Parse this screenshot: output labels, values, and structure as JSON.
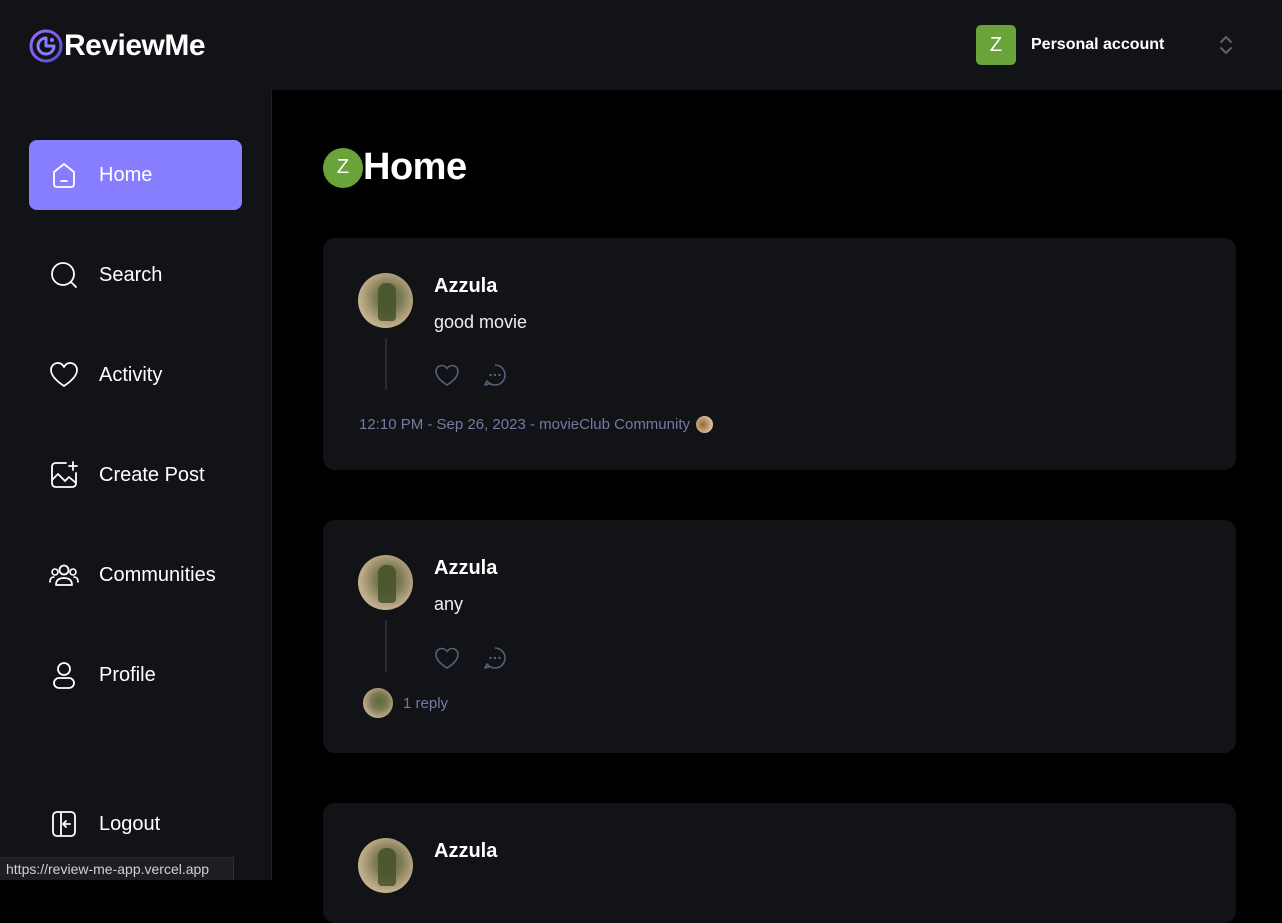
{
  "app": {
    "name": "ReviewMe"
  },
  "account": {
    "avatar_letter": "Z",
    "label": "Personal account",
    "avatar_color": "#6ba33b"
  },
  "sidebar": {
    "items": [
      {
        "label": "Home",
        "icon": "home-icon",
        "active": true
      },
      {
        "label": "Search",
        "icon": "search-icon"
      },
      {
        "label": "Activity",
        "icon": "heart-icon"
      },
      {
        "label": "Create Post",
        "icon": "create-post-icon"
      },
      {
        "label": "Communities",
        "icon": "communities-icon"
      },
      {
        "label": "Profile",
        "icon": "profile-icon"
      }
    ],
    "logout": {
      "label": "Logout",
      "icon": "logout-icon"
    }
  },
  "page": {
    "avatar_letter": "Z",
    "title": "Home"
  },
  "posts": [
    {
      "author": "Azzula",
      "text": "good movie",
      "meta": "12:10 PM - Sep 26, 2023 - movieClub Community"
    },
    {
      "author": "Azzula",
      "text": "any",
      "replies": "1 reply"
    },
    {
      "author": "Azzula"
    }
  ],
  "status_bar": {
    "url": "https://review-me-app.vercel.app"
  },
  "colors": {
    "accent": "#877eff",
    "panel": "#121317",
    "muted": "#7878a3"
  }
}
